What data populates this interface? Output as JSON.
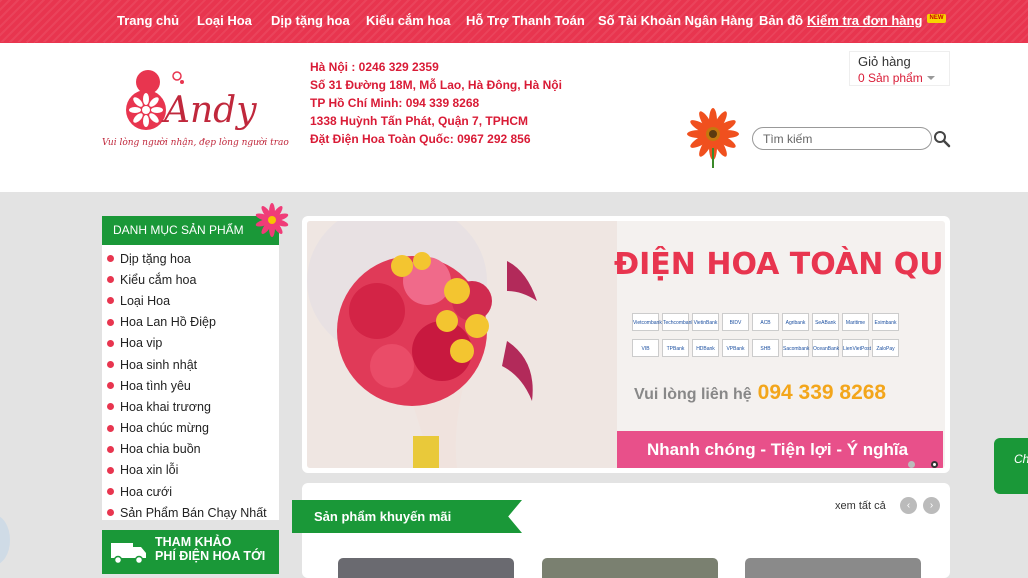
{
  "nav": {
    "items": [
      "Trang chủ",
      "Loại Hoa",
      "Dịp tặng hoa",
      "Kiểu cắm hoa",
      "Hỗ Trợ Thanh Toán",
      "Số Tài Khoản Ngân Hàng",
      "Bản đồ",
      "Kiểm tra đơn hàng"
    ],
    "new_badge": "NEW"
  },
  "logo": {
    "name": "Andy",
    "tagline": "Vui lòng người nhận, đẹp lòng người trao"
  },
  "contact": {
    "lines": [
      "Hà Nội : 0246 329 2359",
      "Số 31 Đường 18M, Mỗ Lao, Hà Đông, Hà Nội",
      "TP Hồ Chí Minh: 094 339 8268",
      "1338 Huỳnh Tấn Phát, Quận 7, TPHCM",
      "Đặt Điện Hoa Toàn Quốc: 0967 292 856"
    ]
  },
  "cart": {
    "title": "Giỏ hàng",
    "count": "0 Sản phẩm"
  },
  "search": {
    "placeholder": "Tìm kiếm"
  },
  "sidebar": {
    "heading": "DANH MỤC SẢN PHẨM",
    "items": [
      "Dịp tặng hoa",
      "Kiểu cắm hoa",
      "Loại Hoa",
      "Hoa Lan Hồ Điệp",
      "Hoa vip",
      "Hoa sinh nhật",
      "Hoa tình yêu",
      "Hoa khai trương",
      "Hoa chúc mừng",
      "Hoa chia buồn",
      "Hoa xin lỗi",
      "Hoa cưới",
      "Sản Phẩm Bán Chạy Nhất"
    ],
    "reference_line1": "THAM KHẢO",
    "reference_line2": "PHÍ ĐIỆN HOA TỚI"
  },
  "slider": {
    "title": "ĐIỆN HOA TOÀN QUỐC",
    "contact_label": "Vui lòng liên hệ",
    "phone": "094 339 8268",
    "band_text": "Nhanh chóng - Tiện lợi - Ý nghĩa",
    "banks_row1": [
      "Vietcombank",
      "Techcombank",
      "VietinBank",
      "BIDV",
      "ACB",
      "Agribank",
      "SeABank",
      "Maritime",
      "Eximbank"
    ],
    "banks_row2": [
      "VIB",
      "TPBank",
      "HDBank",
      "VPBank",
      "SHB",
      "Sacombank",
      "OceanBank",
      "LienVietPost",
      "ZaloPay"
    ],
    "active_dot": 1
  },
  "promo": {
    "heading": "Sản phẩm khuyến mãi",
    "see_all": "xem tất cả",
    "prev": "‹",
    "next": "›"
  },
  "chat": {
    "label": "Ch"
  },
  "colors": {
    "brand_red": "#e8354f",
    "brand_green": "#1a9838",
    "phone_orange": "#f3a61b",
    "band_pink": "#e8508a"
  }
}
